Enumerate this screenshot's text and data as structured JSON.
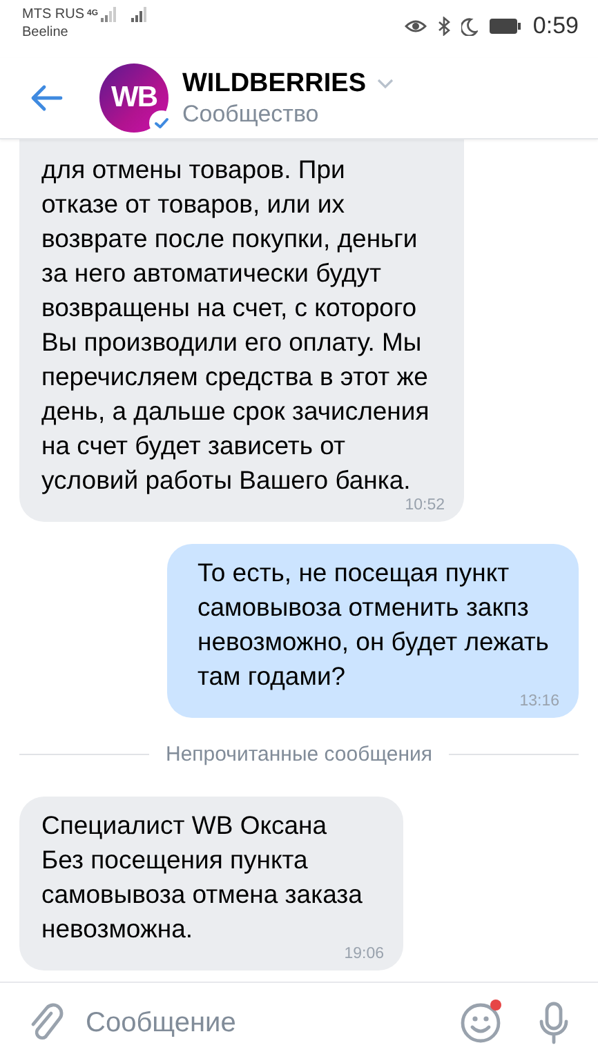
{
  "status_bar": {
    "carrier_1": "MTS RUS",
    "network": "4G",
    "carrier_2": "Beeline",
    "time": "0:59"
  },
  "header": {
    "avatar_text": "WB",
    "title": "WILDBERRIES",
    "subtitle": "Сообщество",
    "verified": true
  },
  "messages": [
    {
      "kind": "incoming",
      "text": "для отмены товаров. При\nотказе от товаров, или их\nвозврате после покупки, деньги\nза него автоматически будут\nвозвращены на счет, с которого\nВы производили его оплату. Мы\nперечисляем средства в этот же\nдень, а дальше срок зачисления\nна счет будет зависеть от\nусловий работы Вашего банка.",
      "time": "10:52",
      "cut_top": true
    },
    {
      "kind": "outgoing",
      "text": "То есть, не посещая пункт\nсамовывоза отменить закпз\nневозможно, он будет лежать\nтам годами?",
      "time": "13:16",
      "cut_top": false
    },
    {
      "kind": "divider",
      "text": "Непрочитанные сообщения"
    },
    {
      "kind": "incoming",
      "text": "Специалист WB Оксана\nБез посещения пункта\nсамовывоза отмена заказа\nневозможна.",
      "time": "19:06",
      "cut_top": false
    }
  ],
  "composer": {
    "placeholder": "Сообщение",
    "emoji_badge": true
  }
}
